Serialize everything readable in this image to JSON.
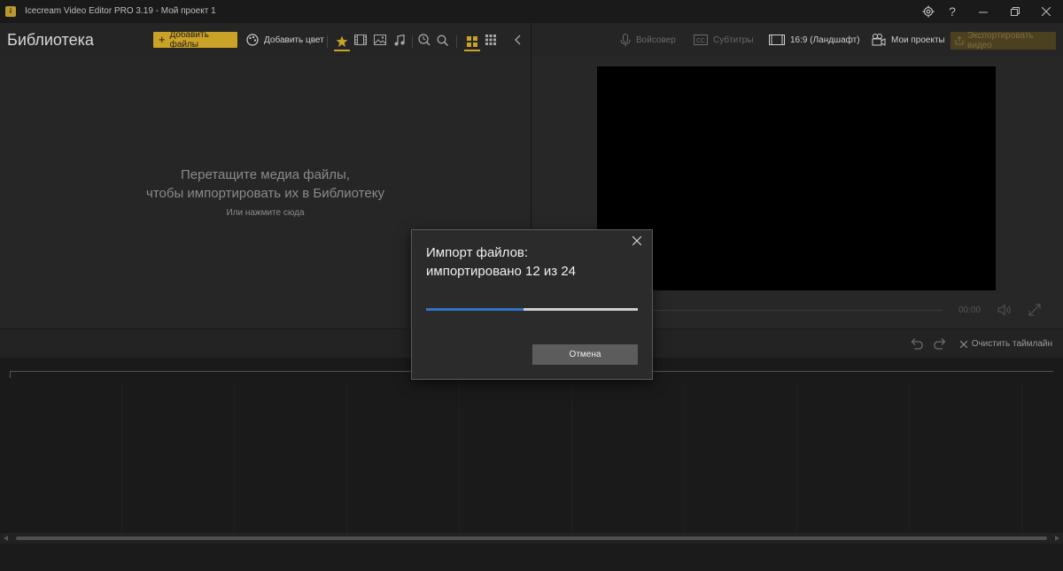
{
  "window": {
    "title": "Icecream Video Editor PRO 3.19  -  Мой проект 1",
    "logo_letter": "i"
  },
  "library": {
    "title": "Библиотека",
    "add_files_label": "Добавить файлы",
    "add_color_label": "Добавить цвет",
    "drop_hint_line1": "Перетащите медиа файлы,",
    "drop_hint_line2": "чтобы импортировать их в Библиотеку",
    "drop_hint_click": "Или нажмите сюда"
  },
  "right_toolbar": {
    "voiceover_label": "Войсовер",
    "subtitles_label": "Субтитры",
    "aspect_label": "16:9 (Ландшафт)",
    "projects_label": "Мои проекты",
    "export_label": "Экспортировать видео"
  },
  "preview": {
    "time": "00:00"
  },
  "timeline": {
    "clear_label": "Очистить таймлайн"
  },
  "import_dialog": {
    "line1": "Импорт файлов:",
    "line2": "импортировано 12 из 24",
    "imported": 12,
    "total": 24,
    "progress_fraction": 0.46,
    "cancel_label": "Отмена"
  },
  "colors": {
    "accent": "#c9a227",
    "progress": "#2f73c2"
  }
}
